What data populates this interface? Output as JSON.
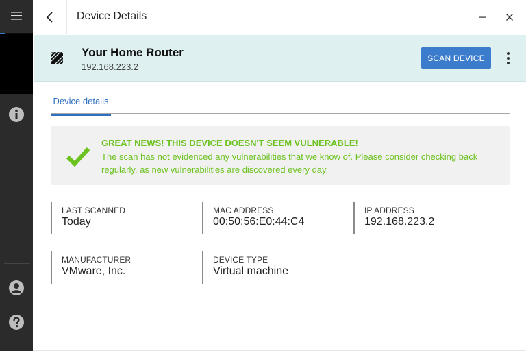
{
  "window": {
    "title": "Device Details"
  },
  "rail": {
    "icons": [
      "hamburger-icon",
      "info-icon",
      "user-icon",
      "help-icon"
    ]
  },
  "device": {
    "name": "Your Home Router",
    "ip": "192.168.223.2",
    "scan_label": "SCAN DEVICE",
    "icon": "router-icon"
  },
  "tabs": [
    {
      "label": "Device details",
      "active": true
    }
  ],
  "result": {
    "title": "GREAT NEWS! THIS DEVICE DOESN'T SEEM VULNERABLE!",
    "message": "The scan has not evidenced any vulnerabilities that we know of. Please consider checking back regularly, as new vulnerabilities are discovered every day."
  },
  "details": [
    {
      "label": "LAST SCANNED",
      "value": "Today"
    },
    {
      "label": "MAC ADDRESS",
      "value": "00:50:56:E0:44:C4"
    },
    {
      "label": "IP ADDRESS",
      "value": "192.168.223.2"
    },
    {
      "label": "MANUFACTURER",
      "value": "VMware, Inc."
    },
    {
      "label": "DEVICE TYPE",
      "value": "Virtual machine"
    }
  ],
  "colors": {
    "accent": "#3b7dcc",
    "success": "#6cc21f",
    "rail": "#2b2b2b",
    "header_bg": "#dff0f0"
  }
}
